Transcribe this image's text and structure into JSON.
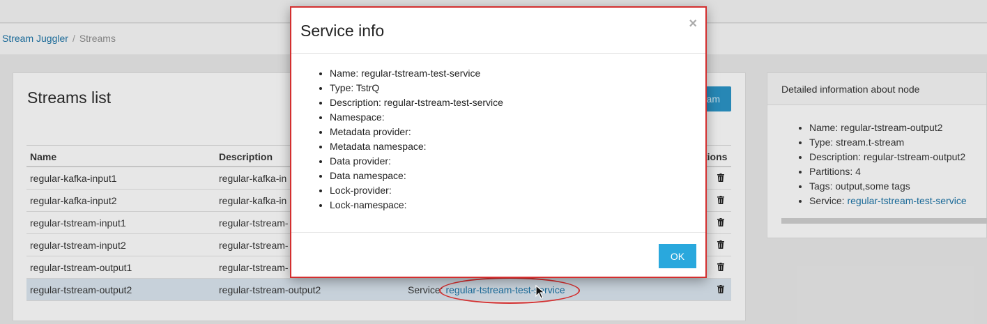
{
  "breadcrumb": {
    "root": "Stream Juggler",
    "separator": "/",
    "current": "Streams"
  },
  "streams_panel": {
    "title": "Streams list",
    "create_button_label": "am"
  },
  "table": {
    "headers": {
      "name": "Name",
      "description": "Description",
      "actions": "tions"
    },
    "rows": [
      {
        "name": "regular-kafka-input1",
        "description": "regular-kafka-in",
        "service_label": "",
        "service": ""
      },
      {
        "name": "regular-kafka-input2",
        "description": "regular-kafka-in",
        "service_label": "",
        "service": ""
      },
      {
        "name": "regular-tstream-input1",
        "description": "regular-tstream-",
        "service_label": "",
        "service": ""
      },
      {
        "name": "regular-tstream-input2",
        "description": "regular-tstream-",
        "service_label": "",
        "service": ""
      },
      {
        "name": "regular-tstream-output1",
        "description": "regular-tstream-",
        "service_label": "",
        "service": ""
      },
      {
        "name": "regular-tstream-output2",
        "description": "regular-tstream-output2",
        "service_label": "Service: ",
        "service": "regular-tstream-test-service"
      }
    ]
  },
  "node_panel": {
    "title": "Detailed information about node",
    "items": [
      {
        "label": "Name: ",
        "value": "regular-tstream-output2"
      },
      {
        "label": "Type: ",
        "value": "stream.t-stream"
      },
      {
        "label": "Description: ",
        "value": "regular-tstream-output2"
      },
      {
        "label": "Partitions: ",
        "value": "4"
      },
      {
        "label": "Tags: ",
        "value": "output,some tags"
      },
      {
        "label": "Service: ",
        "value": "regular-tstream-test-service"
      }
    ]
  },
  "modal": {
    "title": "Service info",
    "close_glyph": "×",
    "items": [
      "Name: regular-tstream-test-service",
      "Type: TstrQ",
      "Description: regular-tstream-test-service",
      "Namespace:",
      "Metadata provider:",
      "Metadata namespace:",
      "Data provider:",
      "Data namespace:",
      "Lock-provider:",
      "Lock-namespace:"
    ],
    "ok_label": "OK"
  },
  "colors": {
    "link": "#1b6fa0",
    "primary": "#29a8dd",
    "highlight": "#d32f2f",
    "selected_row": "#d2dde6"
  },
  "icons": {
    "row_action": "trash-icon",
    "close": "close-icon",
    "pointer": "mouse-cursor-icon"
  }
}
